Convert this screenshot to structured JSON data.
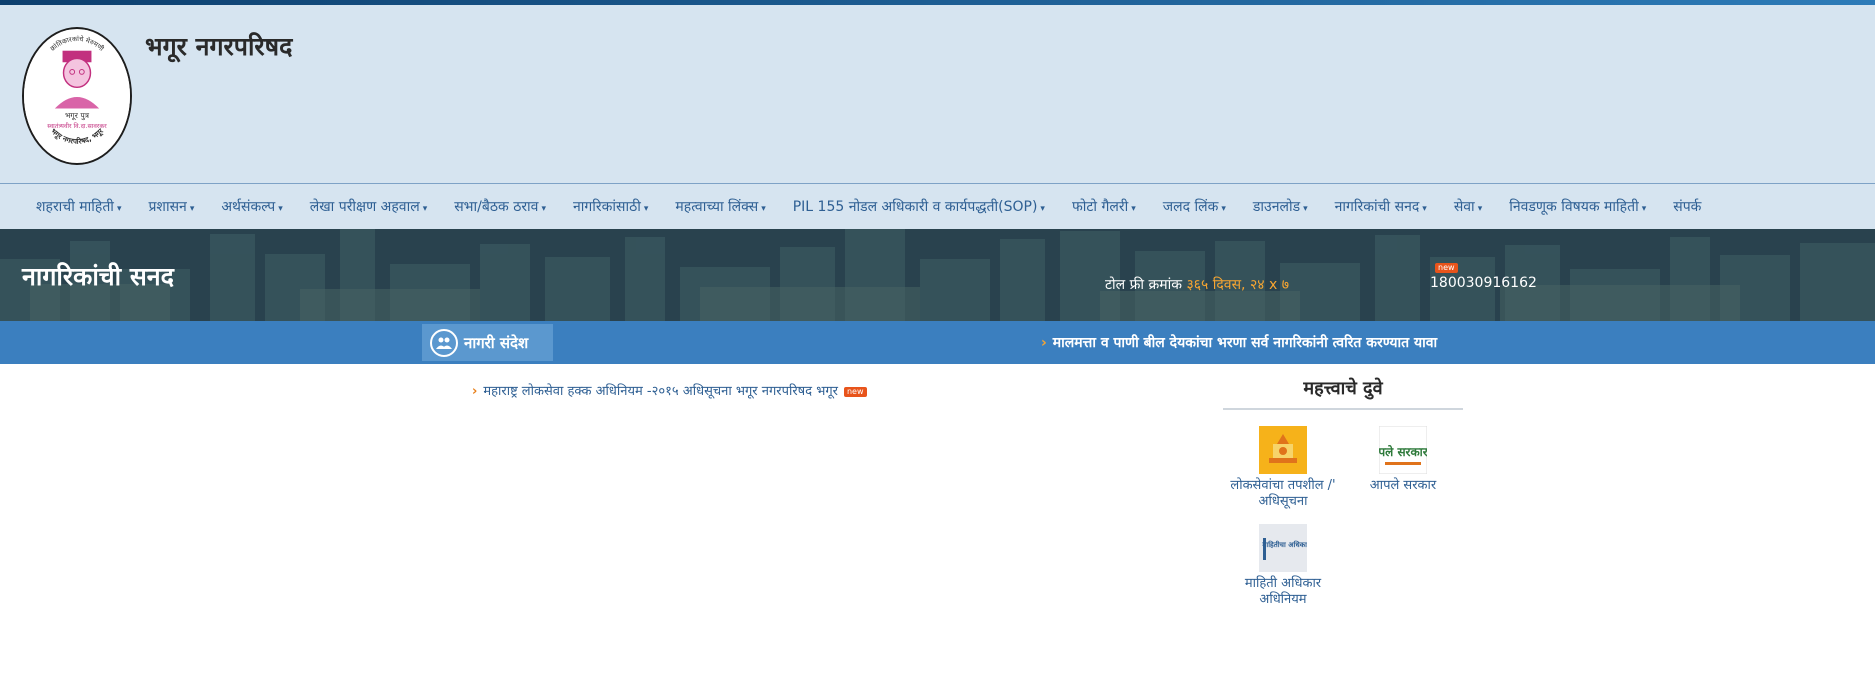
{
  "header": {
    "site_title": "भगूर नगरपरिषद",
    "logo": {
      "top_text": "क्रांतिकारकांचे मेरुमणी",
      "caption_1": "भगूर पुत्र",
      "caption_2": "स्वातंत्र्यवीर वि.दा.सावरकर",
      "bottom_text": "भगूर नगरपरिषद, भगूर"
    }
  },
  "nav": {
    "items": [
      {
        "label": "शहराची माहिती",
        "has_dropdown": true
      },
      {
        "label": "प्रशासन",
        "has_dropdown": true
      },
      {
        "label": "अर्थसंकल्प",
        "has_dropdown": true
      },
      {
        "label": "लेखा परीक्षण अहवाल",
        "has_dropdown": true
      },
      {
        "label": "सभा/बैठक ठराव",
        "has_dropdown": true
      },
      {
        "label": "नागरिकांसाठी",
        "has_dropdown": true
      },
      {
        "label": "महत्वाच्या लिंक्स",
        "has_dropdown": true
      },
      {
        "label": "PIL 155 नोडल अधिकारी व कार्यपद्धती(SOP)",
        "has_dropdown": true
      },
      {
        "label": "फोटो गैलरी",
        "has_dropdown": true
      },
      {
        "label": "जलद लिंक",
        "has_dropdown": true
      },
      {
        "label": "डाउनलोड",
        "has_dropdown": true
      },
      {
        "label": "नागरिकांची सनद",
        "has_dropdown": true
      },
      {
        "label": "सेवा",
        "has_dropdown": true
      },
      {
        "label": "निवडणूक विषयक माहिती",
        "has_dropdown": true
      },
      {
        "label": "संपर्क",
        "has_dropdown": false
      }
    ],
    "caret": "▾"
  },
  "hero": {
    "title": "नागरिकांची सनद",
    "tollfree_label": "टोल फ्री क्रमांक",
    "tollfree_hours": "३६५ दिवस, २४ x ७",
    "phone": "180030916162",
    "new_badge": "new"
  },
  "ticker": {
    "label": "नागरी संदेश",
    "message": "मालमत्ता व पाणी बील देयकांचा भरणा सर्व नागरिकांनी त्वरित करण्यात यावा"
  },
  "main": {
    "notices": [
      {
        "text": "महाराष्ट्र लोकसेवा हक्क अधिनियम -२०१५ अधिसूचना भगूर नगरपरिषद भगूर",
        "badge": "new"
      }
    ]
  },
  "important_links": {
    "title": "महत्त्वाचे दुवे",
    "items": [
      {
        "label": "लोकसेवांचा तपशील /' अधिसूचना",
        "icon": "maharashtra-emblem-icon"
      },
      {
        "label": "आपले सरकार",
        "icon": "aaple-sarkar-icon",
        "logo_text": "पले सरकार"
      },
      {
        "label": "माहिती अधिकार अधिनियम",
        "icon": "rti-icon",
        "logo_text": "माहितीचा अधिकार"
      }
    ]
  },
  "colors": {
    "header_bg": "#d6e4f0",
    "nav_link": "#2e5f93",
    "ticker_bg": "#3b7fbf",
    "accent_orange": "#f7a531"
  }
}
